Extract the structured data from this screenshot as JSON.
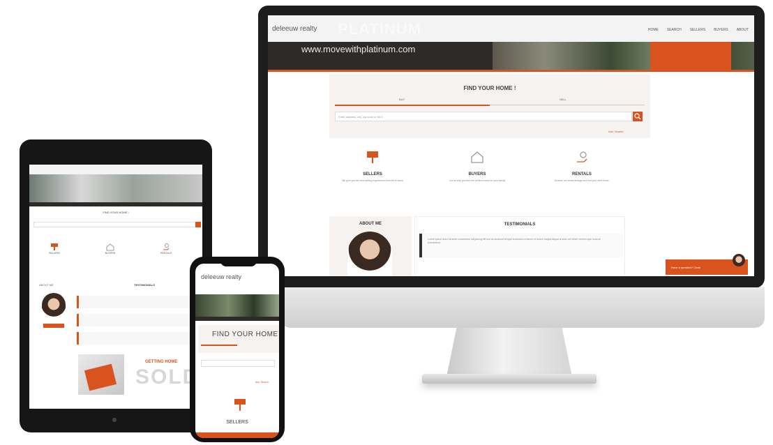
{
  "desktop": {
    "logo": "deleeuw realty",
    "logo_sub": "",
    "hero_overlay": "PLATINUM",
    "nav": [
      "HOME",
      "SEARCH",
      "SELLERS",
      "BUYERS",
      "ABOUT"
    ],
    "hero_url": "www.movewithplatinum.com",
    "find_title": "FIND YOUR HOME !",
    "tabs": [
      "BUY",
      "SELL"
    ],
    "search_placeholder": "Enter address, city, zip code or MLS",
    "advanced_link": "Adv. Search",
    "services": [
      {
        "title": "SELLERS",
        "desc": "We give you the best selling experience from list to close"
      },
      {
        "title": "BUYERS",
        "desc": "Let us help you find the perfect home for your family"
      },
      {
        "title": "RENTALS",
        "desc": "Browse our rental listings and find your next home"
      }
    ],
    "about_title": "ABOUT ME",
    "testimonials_title": "TESTIMONIALS",
    "testimonial_text": "Lorem ipsum dolor sit amet consectetur adipiscing elit sed do eiusmod tempor incididunt ut labore et dolore magna aliqua ut enim ad minim veniam quis nostrud exercitation.",
    "chat_label": "Have a question? Chat!"
  },
  "tablet": {
    "find_title": "FIND YOUR HOME !",
    "services": [
      "SELLERS",
      "BUYERS",
      "RENTALS"
    ],
    "about_label": "ABOUT ME",
    "testimonials_title": "TESTIMONIALS",
    "getting_label": "GETTING HOME",
    "sold_label": "SOLD"
  },
  "phone": {
    "logo": "deleeuw realty",
    "find_title": "FIND YOUR HOME",
    "sellers_label": "SELLERS",
    "advanced_link": "Adv. Search"
  },
  "colors": {
    "accent": "#d9531e",
    "dark": "#2e2a28",
    "panel": "#f5f2f0"
  }
}
